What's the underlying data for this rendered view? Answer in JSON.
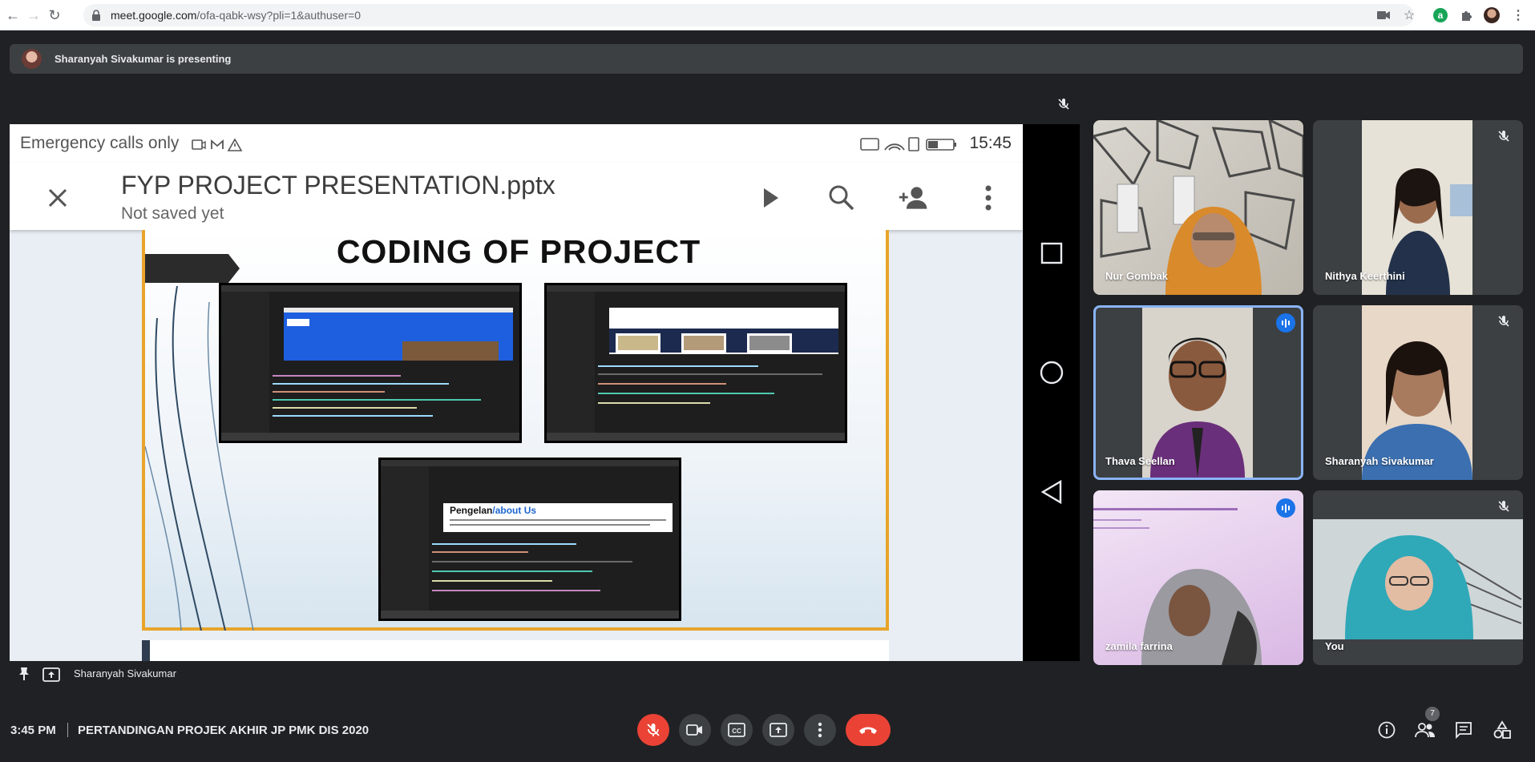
{
  "browser": {
    "url_host": "meet.google.com",
    "url_path": "/ofa-qabk-wsy?pli=1&authuser=0"
  },
  "banner": {
    "text": "Sharanyah Sivakumar is presenting"
  },
  "phone": {
    "status_left": "Emergency calls only",
    "status_time": "15:45",
    "doc_title": "FYP PROJECT PRESENTATION.pptx",
    "doc_subtitle": "Not saved yet"
  },
  "slide": {
    "title": "CODING OF PROJECT",
    "snippet_heading_a": "Pengelan",
    "snippet_heading_b": "/about Us"
  },
  "participants": [
    {
      "name": "Nur Gombak",
      "muted": false,
      "speaking": false
    },
    {
      "name": "Nithya Keerthini",
      "muted": true,
      "speaking": false
    },
    {
      "name": "Thava Seellan",
      "muted": false,
      "speaking": true
    },
    {
      "name": "Sharanyah Sivakumar",
      "muted": true,
      "speaking": false
    },
    {
      "name": "zamila farrina",
      "muted": false,
      "speaking": true
    },
    {
      "name": "You",
      "muted": true,
      "speaking": false
    }
  ],
  "pinned": {
    "name": "Sharanyah Sivakumar"
  },
  "footer": {
    "time": "3:45 PM",
    "meeting_title": "PERTANDINGAN PROJEK AKHIR JP PMK DIS 2020",
    "people_count": "7"
  },
  "colors": {
    "bg": "#202124",
    "panel": "#3c4043",
    "danger": "#ea4335",
    "speaking": "#1a73e8"
  }
}
